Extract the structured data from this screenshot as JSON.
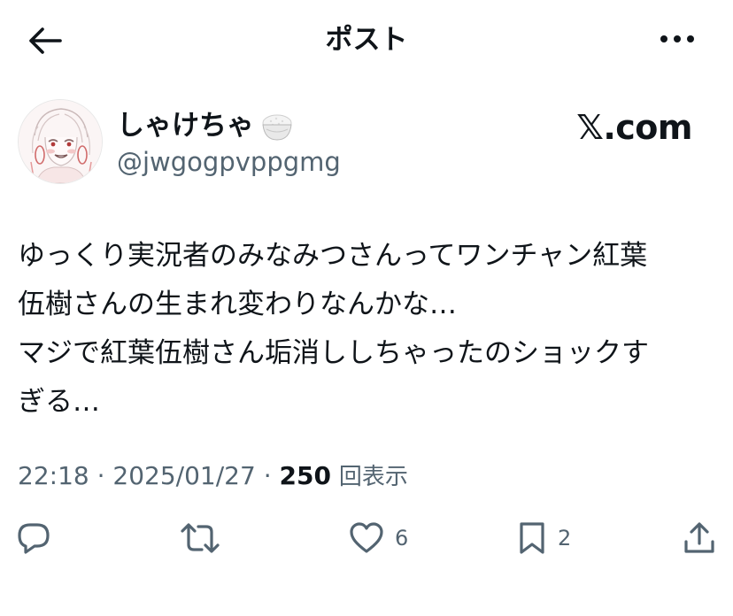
{
  "header": {
    "title": "ポスト",
    "back_icon": "arrow-left-icon",
    "more_icon": "more-horizontal-icon"
  },
  "author": {
    "display_name": "しゃけちゃ",
    "name_emoji": "rice-bowl-icon",
    "handle": "@jwgogpvppgmg",
    "avatar": "avatar-illustration",
    "source_label": "𝕏.com"
  },
  "post": {
    "text": "ゆっくり実況者のみなみつさんってワンチャン紅葉\n伍樹さんの生まれ変わりなんかな…\nマジで紅葉伍樹さん垢消ししちゃったのショックす\nぎる…"
  },
  "meta": {
    "time": "22:18",
    "separator": " · ",
    "date": "2025/01/27",
    "views_count": "250",
    "views_label": "回表示"
  },
  "actions": {
    "reply": {
      "icon": "reply-icon",
      "count": ""
    },
    "repost": {
      "icon": "repost-icon",
      "count": ""
    },
    "like": {
      "icon": "heart-icon",
      "count": "6"
    },
    "bookmark": {
      "icon": "bookmark-icon",
      "count": "2"
    },
    "share": {
      "icon": "share-icon",
      "count": ""
    }
  },
  "colors": {
    "text_primary": "#0f1419",
    "text_secondary": "#536471",
    "background": "#ffffff"
  }
}
